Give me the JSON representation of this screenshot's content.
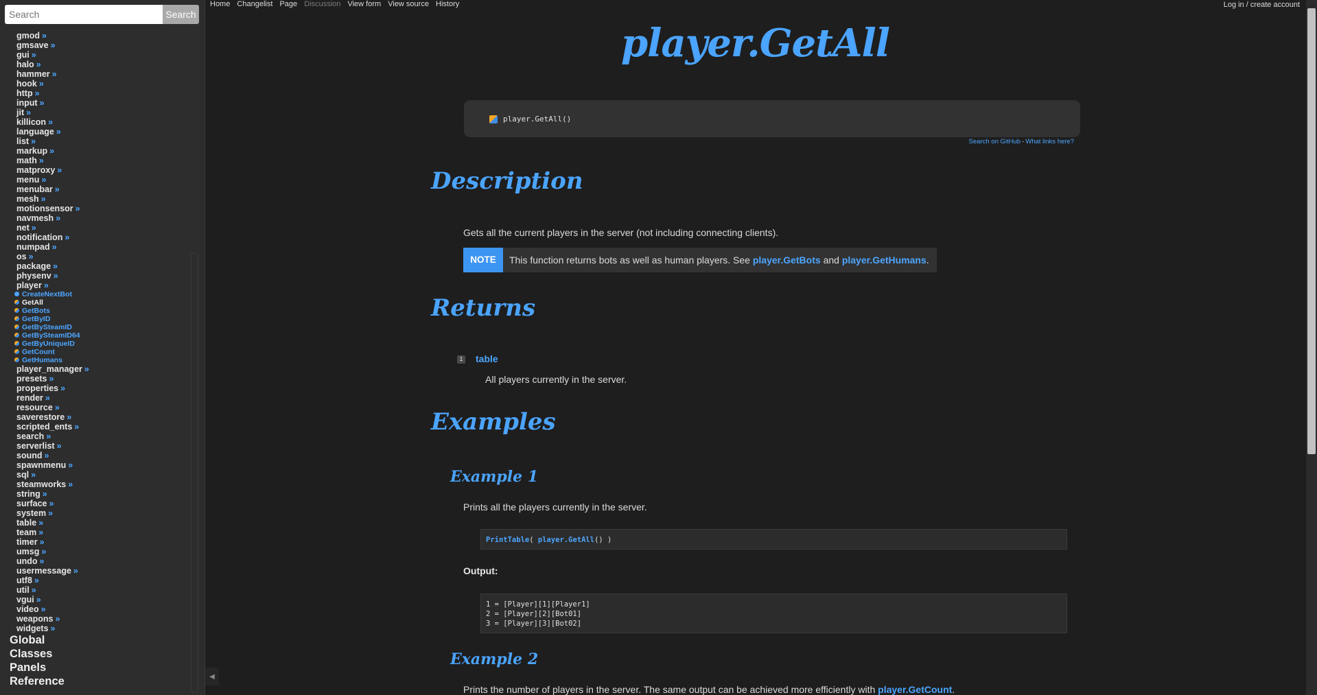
{
  "sidebar": {
    "search_placeholder": "Search",
    "search_button": "Search",
    "modules_before": [
      "gmod",
      "gmsave",
      "gui",
      "halo",
      "hammer",
      "hook",
      "http",
      "input",
      "jit",
      "killicon",
      "language",
      "list",
      "markup",
      "math",
      "matproxy",
      "menu",
      "menubar",
      "mesh",
      "motionsensor",
      "navmesh",
      "net",
      "notification",
      "numpad",
      "os",
      "package",
      "physenv",
      "player"
    ],
    "player_functions": [
      "CreateNextBot",
      "GetAll",
      "GetBots",
      "GetByID",
      "GetBySteamID",
      "GetBySteamID64",
      "GetByUniqueID",
      "GetCount",
      "GetHumans"
    ],
    "active_function": "GetAll",
    "modules_after": [
      "player_manager",
      "presets",
      "properties",
      "render",
      "resource",
      "saverestore",
      "scripted_ents",
      "search",
      "serverlist",
      "sound",
      "spawnmenu",
      "sql",
      "steamworks",
      "string",
      "surface",
      "system",
      "table",
      "team",
      "timer",
      "umsg",
      "undo",
      "usermessage",
      "utf8",
      "util",
      "vgui",
      "video",
      "weapons",
      "widgets"
    ],
    "sections": [
      "Global",
      "Classes",
      "Panels",
      "Reference"
    ],
    "chevron": "»"
  },
  "topbar": {
    "home": "Home",
    "changelist": "Changelist",
    "page": "Page",
    "discussion": "Discussion",
    "view_form": "View form",
    "view_source": "View source",
    "history": "History",
    "login": "Log in / create account"
  },
  "page": {
    "title": "player.GetAll",
    "signature": "player.GetAll()",
    "search_github": "Search on GitHub",
    "link_separator": "-",
    "what_links_here": "What links here?",
    "description_heading": "Description",
    "description_text": "Gets all the current players in the server (not including connecting clients).",
    "note_label": "NOTE",
    "note_prefix": "This function returns bots as well as human players. See",
    "note_link1_module": "player",
    "note_link1_fn": "GetBots",
    "note_and": "and",
    "note_link2_module": "player",
    "note_link2_fn": "GetHumans",
    "note_end": ".",
    "returns_heading": "Returns",
    "return_index": "1",
    "return_type": "table",
    "return_desc": "All players currently in the server.",
    "examples_heading": "Examples",
    "example1_heading": "Example 1",
    "example1_desc": "Prints all the players currently in the server.",
    "example1_code_fn": "PrintTable",
    "example1_code_open": "(",
    "example1_code_module": "player",
    "example1_code_method": "GetAll",
    "example1_code_close": "() )",
    "output_label": "Output:",
    "output_lines": [
      "1 = [Player][1][Player1]",
      "2 = [Player][2][Bot01]",
      "3 = [Player][3][Bot02]"
    ],
    "example2_heading": "Example 2",
    "example2_prefix": "Prints the number of players in the server. The same output can be achieved more efficiently with",
    "example2_link_module": "player",
    "example2_link_fn": "GetCount",
    "example2_end": "."
  }
}
